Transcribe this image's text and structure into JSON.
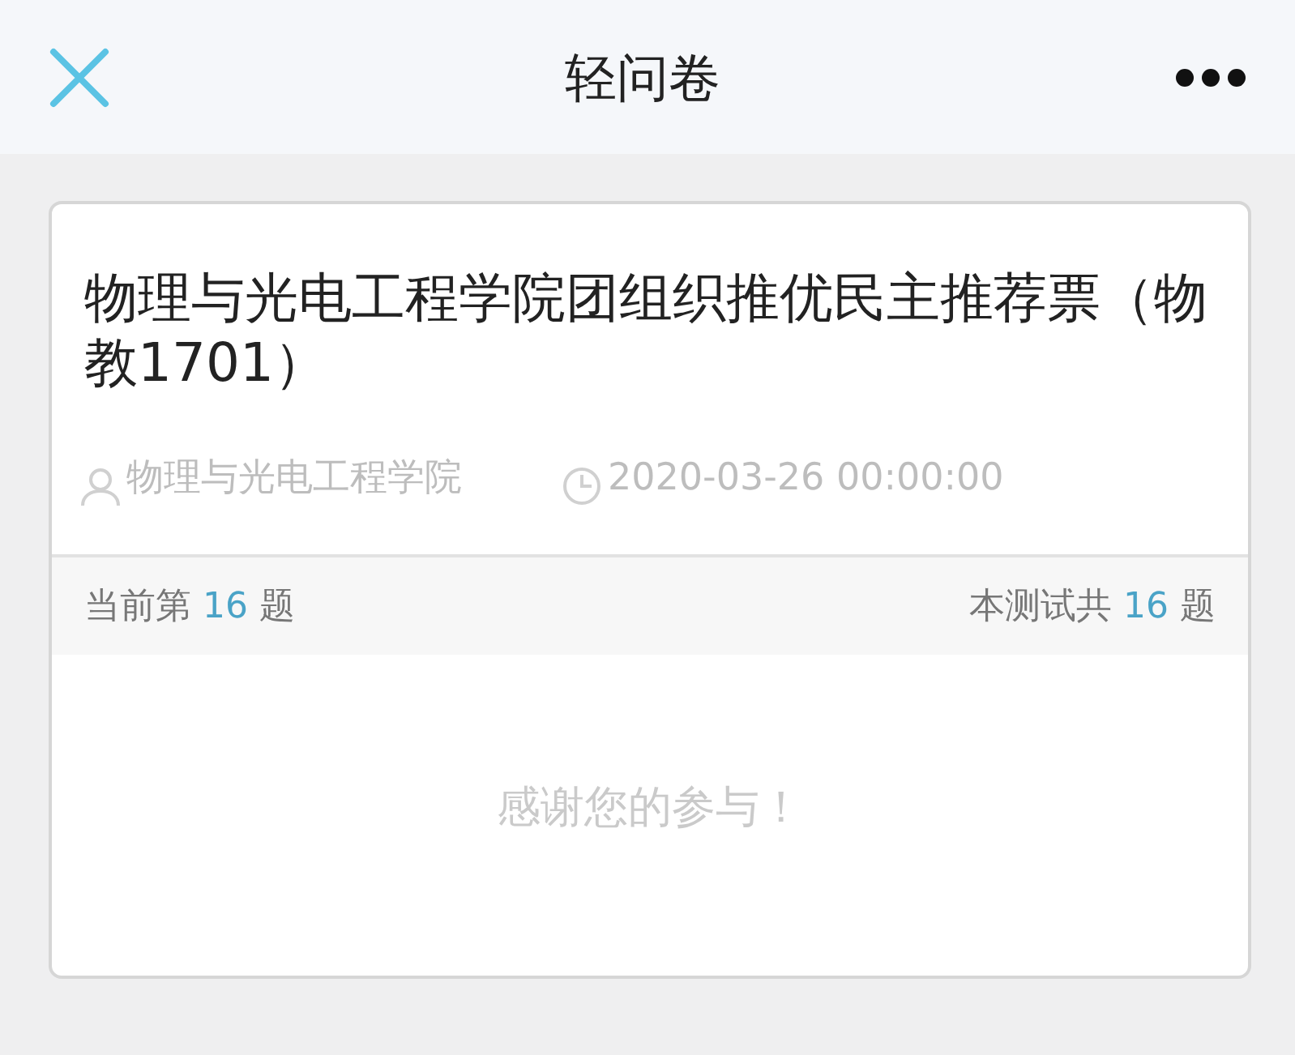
{
  "header": {
    "title": "轻问卷"
  },
  "survey": {
    "title": "物理与光电工程学院团组织推优民主推荐票（物教1701）",
    "author": "物理与光电工程学院",
    "date": "2020-03-26 00:00:00"
  },
  "progress": {
    "current": {
      "prefix": "当前第",
      "number": "16",
      "suffix": "题"
    },
    "total": {
      "prefix": "本测试共",
      "number": "16",
      "suffix": "题"
    }
  },
  "message": "感谢您的参与！"
}
